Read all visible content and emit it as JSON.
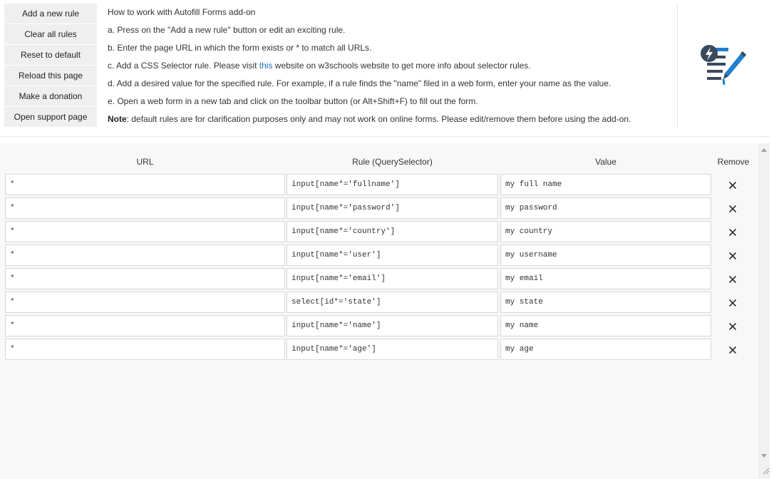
{
  "sidebar": {
    "buttons": [
      {
        "label": "Add a new rule"
      },
      {
        "label": "Clear all rules"
      },
      {
        "label": "Reset to default"
      },
      {
        "label": "Reload this page"
      },
      {
        "label": "Make a donation"
      },
      {
        "label": "Open support page"
      }
    ]
  },
  "help": {
    "title": "How to work with Autofill Forms add-on",
    "step_a": "a. Press on the \"Add a new rule\" button or edit an exciting rule.",
    "step_b": "b. Enter the page URL in which the form exists or * to match all URLs.",
    "step_c_prefix": "c. Add a CSS Selector rule. Please visit ",
    "step_c_link": "this",
    "step_c_suffix": " website on w3schools website to get more info about selector rules.",
    "step_d": "d. Add a desired value for the specified rule. For example, if a rule finds the \"name\" filed in a web form, enter your name as the value.",
    "step_e": "e. Open a web form in a new tab and click on the toolbar button (or Alt+Shift+F) to fill out the form.",
    "note_label": "Note",
    "note_text": ": default rules are for clarification purposes only and may not work on online forms. Please edit/remove them before using the add-on."
  },
  "table": {
    "headers": {
      "url": "URL",
      "rule": "Rule (QuerySelector)",
      "value": "Value",
      "remove": "Remove"
    },
    "rows": [
      {
        "url": "*",
        "rule": "input[name*='fullname']",
        "value": "my full name"
      },
      {
        "url": "*",
        "rule": "input[name*='password']",
        "value": "my password"
      },
      {
        "url": "*",
        "rule": "input[name*='country']",
        "value": "my country"
      },
      {
        "url": "*",
        "rule": "input[name*='user']",
        "value": "my username"
      },
      {
        "url": "*",
        "rule": "input[name*='email']",
        "value": "my email"
      },
      {
        "url": "*",
        "rule": "select[id*='state']",
        "value": "my state"
      },
      {
        "url": "*",
        "rule": "input[name*='name']",
        "value": "my name"
      },
      {
        "url": "*",
        "rule": "input[name*='age']",
        "value": "my age"
      }
    ]
  },
  "icons": {
    "logo": "autofill-forms-logo-icon",
    "remove": "close-icon",
    "scroll_up": "arrow-up-icon",
    "scroll_down": "arrow-down-icon"
  },
  "colors": {
    "link": "#1a6fb4",
    "logo_blue": "#1f7fd1",
    "logo_dark": "#3a4a5c",
    "button_bg": "#efefef",
    "table_bg": "#f8f8f8"
  }
}
